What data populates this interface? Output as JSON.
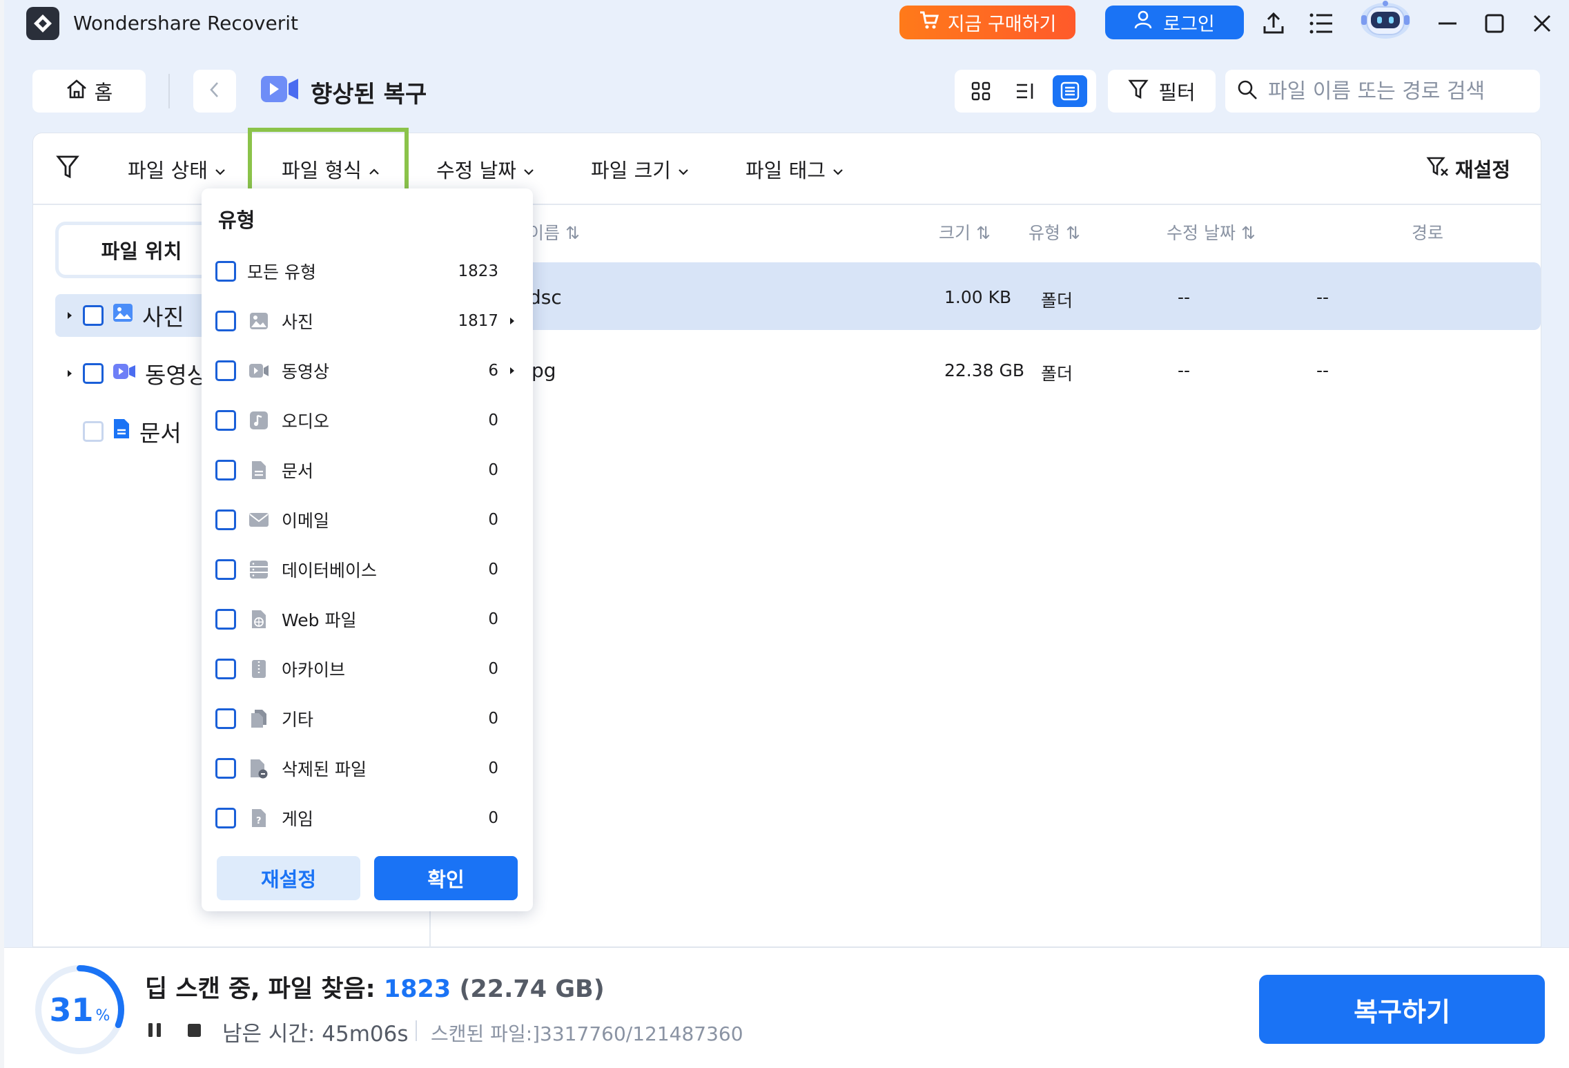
{
  "titlebar": {
    "app_title": "Wondershare Recoverit",
    "buy_label": "지금 구매하기",
    "login_label": "로그인",
    "icons": [
      "export-icon",
      "menu-icon",
      "robot-assistant-icon",
      "minimize-icon",
      "maximize-icon",
      "close-icon"
    ]
  },
  "toolbar": {
    "home_label": "홈",
    "page_title": "향상된 복구",
    "filter_label": "필터",
    "search_placeholder": "파일 이름 또는 경로 검색"
  },
  "filter_bar": {
    "items": [
      "파일 상태",
      "파일 형식",
      "수정 날짜",
      "파일 크기",
      "파일 태그"
    ],
    "reset_label": "재설정"
  },
  "sidebar": {
    "tab_label": "파일 위치",
    "tree": [
      {
        "label": "사진",
        "icon": "photo-icon"
      },
      {
        "label": "동영상",
        "icon": "video-icon"
      },
      {
        "label": "문서",
        "icon": "document-icon"
      }
    ]
  },
  "table": {
    "headers": {
      "name": "이름",
      "size": "크기",
      "type": "유형",
      "modified": "수정 날짜",
      "path": "경로"
    },
    "rows": [
      {
        "name": "dsc",
        "size": "1.00 KB",
        "type": "폴더",
        "modified": "--",
        "path": "--"
      },
      {
        "name": "pg",
        "size": "22.38 GB",
        "type": "폴더",
        "modified": "--",
        "path": "--"
      }
    ]
  },
  "dropdown": {
    "title": "유형",
    "items": [
      {
        "label": "모든 유형",
        "count": "1823"
      },
      {
        "label": "사진",
        "count": "1817"
      },
      {
        "label": "동영상",
        "count": "6"
      },
      {
        "label": "오디오",
        "count": "0"
      },
      {
        "label": "문서",
        "count": "0"
      },
      {
        "label": "이메일",
        "count": "0"
      },
      {
        "label": "데이터베이스",
        "count": "0"
      },
      {
        "label": "Web 파일",
        "count": "0"
      },
      {
        "label": "아카이브",
        "count": "0"
      },
      {
        "label": "기타",
        "count": "0"
      },
      {
        "label": "삭제된 파일",
        "count": "0"
      },
      {
        "label": "게임",
        "count": "0"
      }
    ],
    "reset_label": "재설정",
    "confirm_label": "확인"
  },
  "bottom": {
    "progress_value": "31",
    "progress_unit": "%",
    "progress_fraction": 0.31,
    "status_prefix": "딥 스캔 중, 파일 찾음:",
    "found_count": "1823",
    "found_size": "(22.74 GB)",
    "remaining_label": "남은 시간:",
    "remaining_value": "45m06s",
    "scanned_label": "스캔된 파일:]3317760/121487360",
    "recover_label": "복구하기"
  },
  "colors": {
    "accent": "#1a73f5",
    "buy_start": "#ff7a1a",
    "highlight": "#8bc34a"
  }
}
